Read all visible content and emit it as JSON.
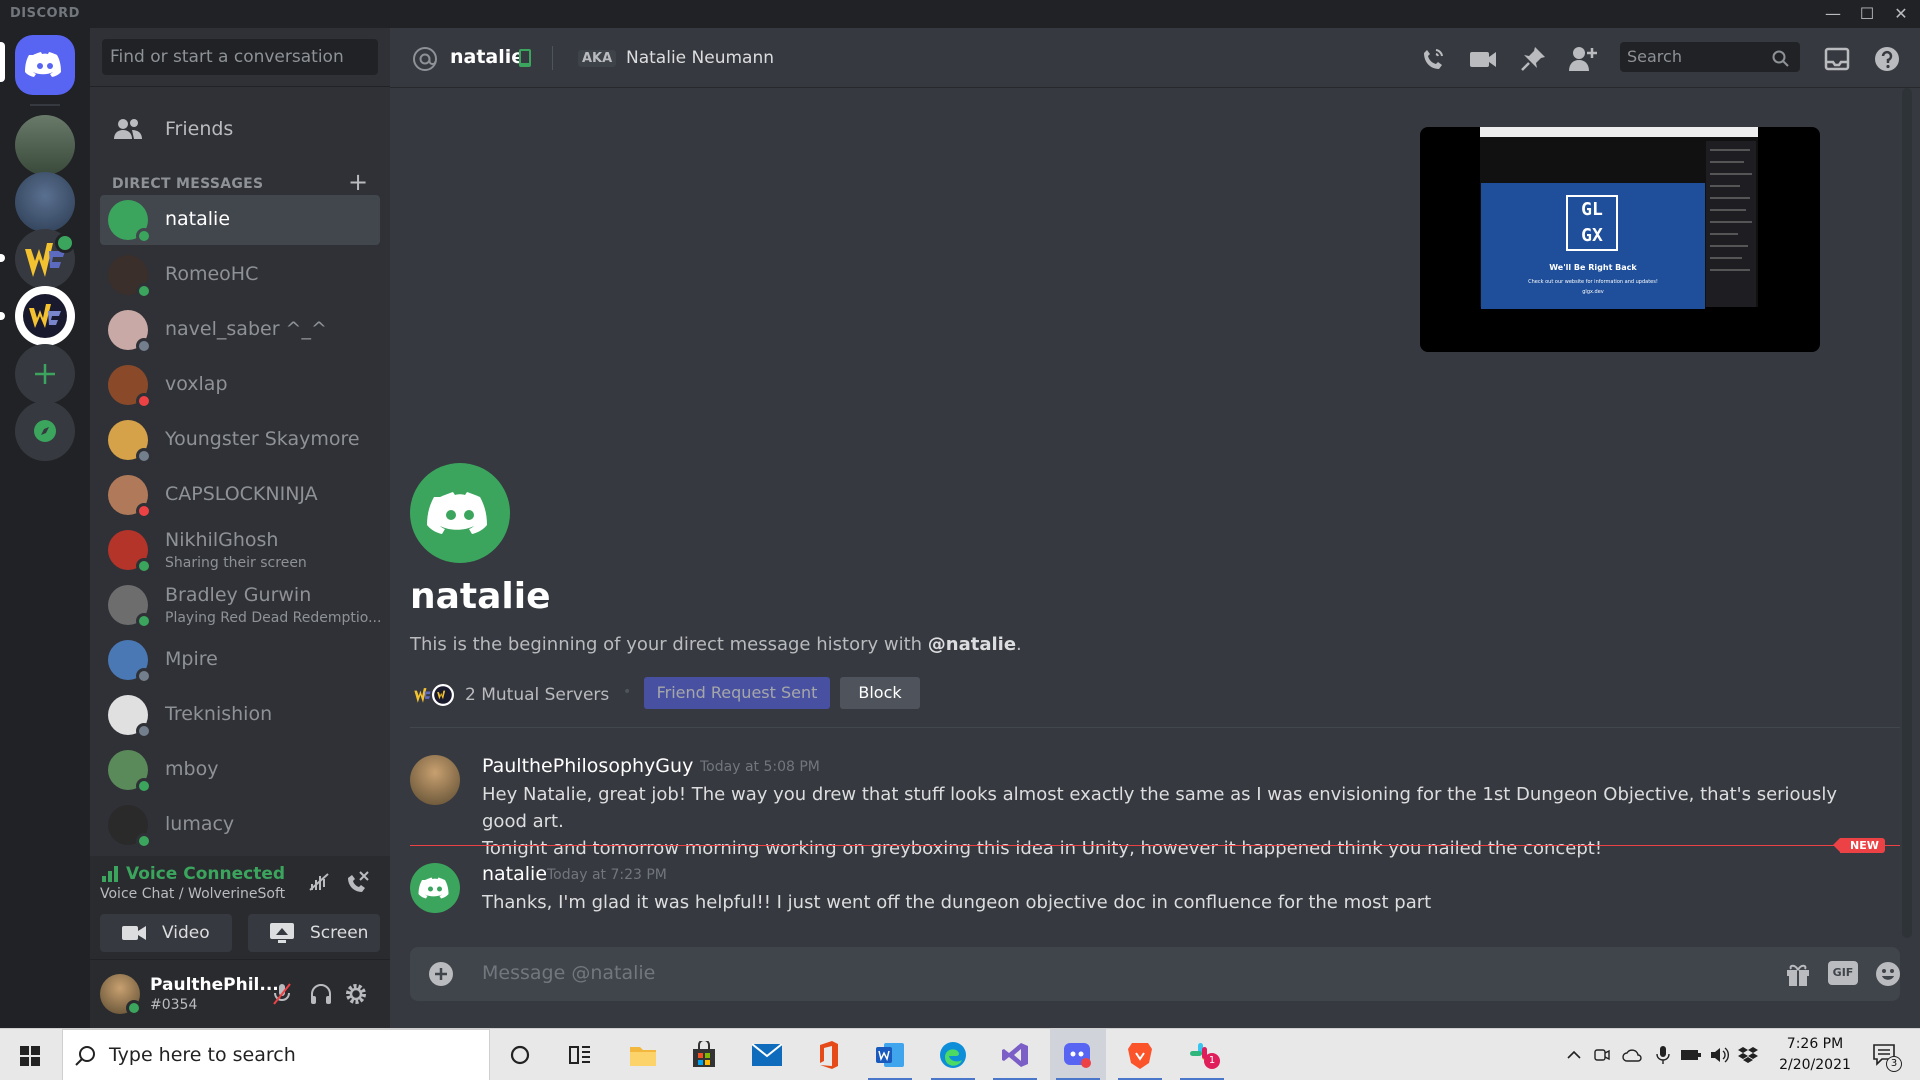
{
  "app": {
    "brand": "DISCORD"
  },
  "window_controls": {
    "minimize": "—",
    "maximize": "☐",
    "close": "✕"
  },
  "sidebar": {
    "search_placeholder": "Find or start a conversation",
    "friends_label": "Friends",
    "dm_header": "DIRECT MESSAGES",
    "dm_add": "+",
    "dms": [
      {
        "name": "natalie",
        "status": "",
        "color": "#3ba55d",
        "status_color": "#3ba55d"
      },
      {
        "name": "RomeoHC",
        "status": "",
        "color": "#3a2f2a",
        "status_color": "#3ba55d"
      },
      {
        "name": "navel_saber ^_^",
        "status": "",
        "color": "#c9a9a6",
        "status_color": "#747f8d"
      },
      {
        "name": "voxlap",
        "status": "",
        "color": "#8a4a2a",
        "status_color": "#ed4245"
      },
      {
        "name": "Youngster Skaymore",
        "status": "",
        "color": "#d5a24a",
        "status_color": "#747f8d"
      },
      {
        "name": "CAPSLOCKNINJA",
        "status": "",
        "color": "#b07a5a",
        "status_color": "#ed4245"
      },
      {
        "name": "NikhilGhosh",
        "status": "Sharing their screen",
        "color": "#b4342a",
        "status_color": "#3ba55d"
      },
      {
        "name": "Bradley Gurwin",
        "status": "Playing Red Dead Redemptio...",
        "color": "#6d6d6d",
        "status_color": "#3ba55d"
      },
      {
        "name": "Mpire",
        "status": "",
        "color": "#4a78b5",
        "status_color": "#747f8d"
      },
      {
        "name": "Treknishion",
        "status": "",
        "color": "#e0e0e0",
        "status_color": "#747f8d"
      },
      {
        "name": "mboy",
        "status": "",
        "color": "#5a8a5a",
        "status_color": "#3ba55d"
      },
      {
        "name": "lumacy",
        "status": "",
        "color": "#2a2a2a",
        "status_color": "#3ba55d"
      }
    ]
  },
  "voice": {
    "status": "Voice Connected",
    "channel": "Voice Chat / WolverineSoft",
    "video_label": "Video",
    "screen_label": "Screen"
  },
  "user": {
    "name": "PaulthePhil...",
    "tag": "#0354"
  },
  "header": {
    "at_symbol": "@",
    "name": "natalie",
    "aka_label": "AKA",
    "real_name": "Natalie Neumann",
    "search_placeholder": "Search"
  },
  "intro": {
    "name": "natalie",
    "text_before": "This is the beginning of your direct message history with ",
    "text_handle": "@natalie",
    "text_after": ".",
    "mutual_servers": "2 Mutual Servers",
    "mutual_dot": "•",
    "friend_request_label": "Friend Request Sent",
    "block_label": "Block"
  },
  "stream_preview": {
    "logo_top": "GL",
    "logo_bottom": "GX",
    "title": "We'll Be Right Back",
    "subtitle": "Check out our website for information and updates!",
    "url": "glgx.dev"
  },
  "messages": [
    {
      "author": "PaulthePhilosophyGuy",
      "time": "Today at 5:08 PM",
      "lines": [
        "Hey Natalie, great job! The way you drew that stuff looks almost exactly the same as I was envisioning for the 1st Dungeon Objective, that's seriously good art.",
        "Tonight and tomorrow morning working on greyboxing this idea in Unity, however it happened think you nailed the concept!"
      ]
    },
    {
      "author": "natalie",
      "time": "Today at 7:23 PM",
      "lines": [
        "Thanks, I'm glad it was helpful!! I just went off the dungeon objective doc in confluence for the most part"
      ]
    }
  ],
  "new_badge": "NEW",
  "composer": {
    "placeholder": "Message @natalie",
    "gif_label": "GIF"
  },
  "taskbar": {
    "search_placeholder": "Type here to search",
    "time": "7:26 PM",
    "date": "2/20/2021",
    "notification_count": "3",
    "slack_badge": "1"
  },
  "colors": {
    "blurple": "#5865f2",
    "online": "#3ba55d",
    "dnd": "#ed4245",
    "offline": "#747f8d"
  }
}
